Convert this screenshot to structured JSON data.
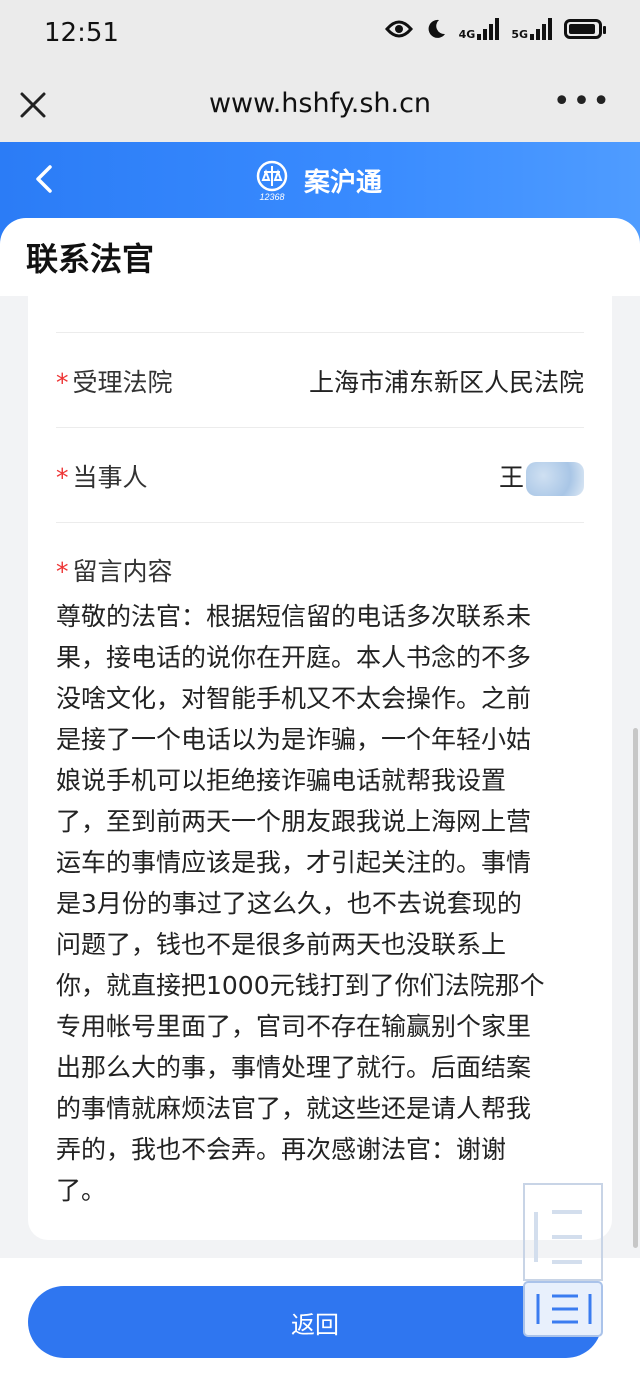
{
  "status_bar": {
    "time": "12:51",
    "signal1": "4G",
    "signal2": "5G",
    "icons": [
      "eye-icon",
      "moon-icon",
      "signal-icon",
      "signal-icon",
      "battery-icon"
    ]
  },
  "browser": {
    "url": "www.hshfy.sh.cn"
  },
  "app": {
    "name": "案沪通",
    "emblem_text": "12368",
    "accent": "#2f76f0"
  },
  "page": {
    "title": "联系法官"
  },
  "form": {
    "court_label": "受理法院",
    "court_value": "上海市浦东新区人民法院",
    "party_label": "当事人",
    "party_value": "王",
    "message_label": "留言内容",
    "required_mark": "*",
    "message_lines": [
      "尊敬的法官：根据短信留的电话多次联系未",
      "果，接电话的说你在开庭。本人书念的不多",
      "没啥文化，对智能手机又不太会操作。之前",
      "是接了一个电话以为是诈骗，一个年轻小姑",
      "娘说手机可以拒绝接诈骗电话就帮我设置",
      "了，至到前两天一个朋友跟我说上海网上营",
      "运车的事情应该是我，才引起关注的。事情",
      "是3月份的事过了这么久，也不去说套现的",
      "问题了，钱也不是很多前两天也没联系上",
      "你，就直接把1000元钱打到了你们法院那个",
      "专用帐号里面了，官司不存在输赢别个家里",
      "出那么大的事，事情处理了就行。后面结案",
      "的事情就麻烦法官了，就这些还是请人帮我",
      "弄的，我也不会弄。再次感谢法官：谢谢",
      "了。"
    ]
  },
  "footer": {
    "back_button": "返回"
  }
}
